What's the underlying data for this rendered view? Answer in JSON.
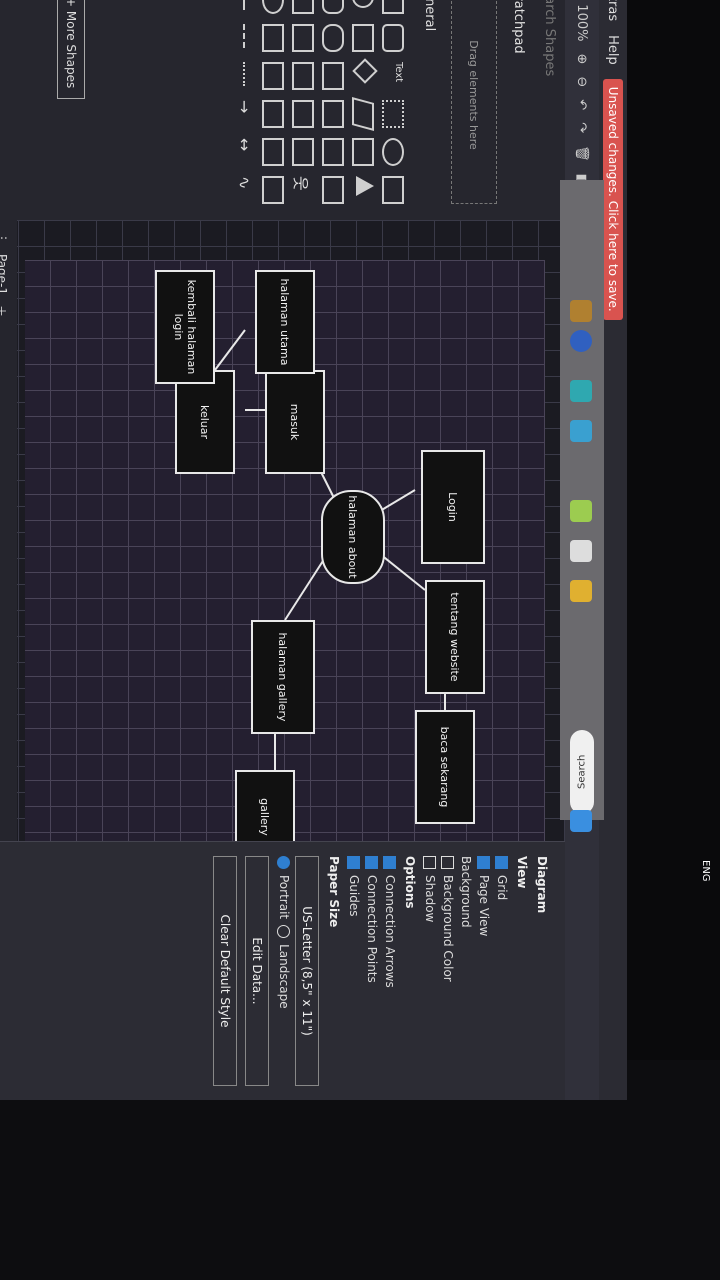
{
  "menubar": {
    "menu_extras": "Extras",
    "menu_help": "Help",
    "unsaved": "Unsaved changes. Click here to save."
  },
  "toolbar": {
    "zoom": "100%"
  },
  "sidebar": {
    "search_placeholder": "Search Shapes",
    "scratchpad": "Scratchpad",
    "drag_here": "Drag elements here",
    "general": "General",
    "more_shapes": "+ More Shapes"
  },
  "diagram": {
    "nodes": {
      "login": "Login",
      "halaman_about": "halaman about",
      "tentang_website": "tentang website",
      "baca_sekarang": "baca sekarang",
      "masuk": "masuk",
      "keluar": "keluar",
      "halaman_utama": "halaman utama",
      "kembali_halaman_login": "kembali halaman login",
      "halaman_gallery": "halaman gallery",
      "gallery": "gallery"
    }
  },
  "pagetabs": {
    "page": "Page-1"
  },
  "rightpanel": {
    "title": "Diagram",
    "view": "View",
    "grid": "Grid",
    "page_view": "Page View",
    "background": "Background",
    "background_color": "Background Color",
    "shadow": "Shadow",
    "options": "Options",
    "connection_arrows": "Connection Arrows",
    "connection_points": "Connection Points",
    "guides": "Guides",
    "paper_size": "Paper Size",
    "paper_value": "US-Letter (8,5\" x 11\")",
    "portrait": "Portrait",
    "landscape": "Landscape",
    "edit_data": "Edit Data...",
    "clear_default_style": "Clear Default Style"
  },
  "taskbar": {
    "search": "Search",
    "lang": "ENG"
  }
}
